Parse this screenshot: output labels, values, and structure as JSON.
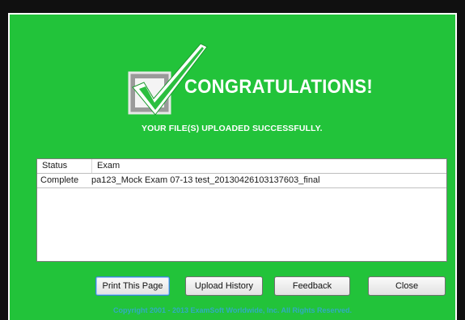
{
  "window": {
    "colors": {
      "background": "#22c33a",
      "frame": "#101010",
      "title_text": "#ffffff"
    }
  },
  "header": {
    "icon": "checkmark-icon",
    "title": "CONGRATULATIONS!",
    "subtitle": "YOUR FILE(S) UPLOADED SUCCESSFULLY."
  },
  "table": {
    "columns": [
      "Status",
      "Exam"
    ],
    "rows": [
      {
        "status": "Complete",
        "exam": "pa123_Mock Exam 07-13 test_20130426103137603_final"
      }
    ]
  },
  "buttons": {
    "print": "Print This Page",
    "history": "Upload History",
    "feedback": "Feedback",
    "close": "Close"
  },
  "footer": {
    "copyright": "Copyright 2001 - 2013 ExamSoft Worldwide, Inc. All Rights Reserved."
  }
}
